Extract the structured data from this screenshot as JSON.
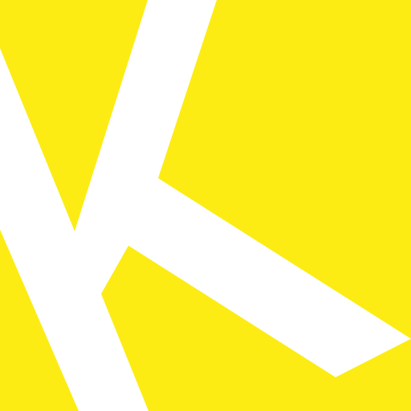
{
  "app_icon": {
    "icon": "k-logo-icon",
    "colors": {
      "background": "#fcec14",
      "glyph": "#ffffff"
    }
  }
}
